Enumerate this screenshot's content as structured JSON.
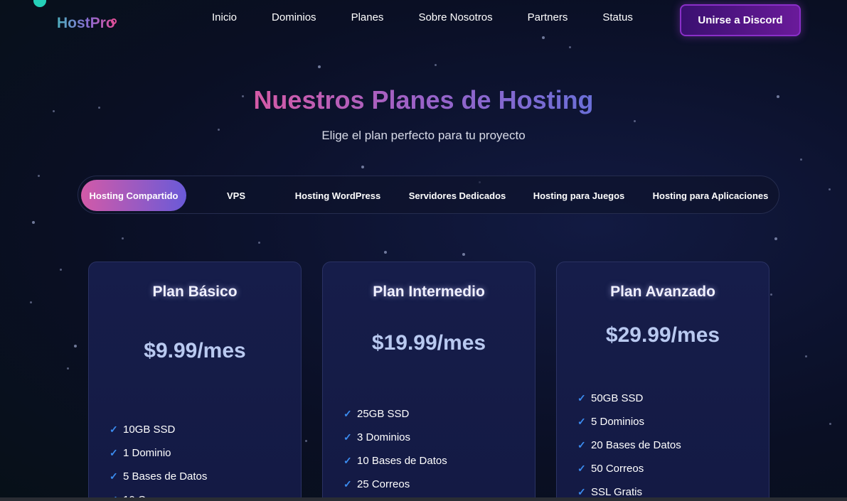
{
  "header": {
    "logo": "HostPro",
    "nav": [
      "Inicio",
      "Dominios",
      "Planes",
      "Sobre Nosotros",
      "Partners",
      "Status"
    ],
    "discord_button": "Unirse a Discord"
  },
  "hero": {
    "title": "Nuestros Planes de Hosting",
    "subtitle": "Elige el plan perfecto para tu proyecto"
  },
  "tabs": {
    "items": [
      "Hosting Compartido",
      "VPS",
      "Hosting WordPress",
      "Servidores Dedicados",
      "Hosting para Juegos",
      "Hosting para Aplicaciones"
    ],
    "active": "Hosting Compartido"
  },
  "plans": [
    {
      "name": "Plan Básico",
      "price": "$9.99/mes",
      "features": [
        "10GB SSD",
        "1 Dominio",
        "5 Bases de Datos",
        "10 C"
      ]
    },
    {
      "name": "Plan Intermedio",
      "price": "$19.99/mes",
      "features": [
        "25GB SSD",
        "3 Dominios",
        "10 Bases de Datos",
        "25 Correos"
      ]
    },
    {
      "name": "Plan Avanzado",
      "price": "$29.99/mes",
      "features": [
        "50GB SSD",
        "5 Dominios",
        "20 Bases de Datos",
        "50 Correos",
        "SSL Gratis"
      ]
    }
  ],
  "colors": {
    "accent_pink": "#d25aa8",
    "accent_purple": "#6a5ad8",
    "check_blue": "#3b8cf0",
    "discord_purple": "#6a1a9a"
  },
  "icons": {
    "feature_check": "check-icon"
  }
}
